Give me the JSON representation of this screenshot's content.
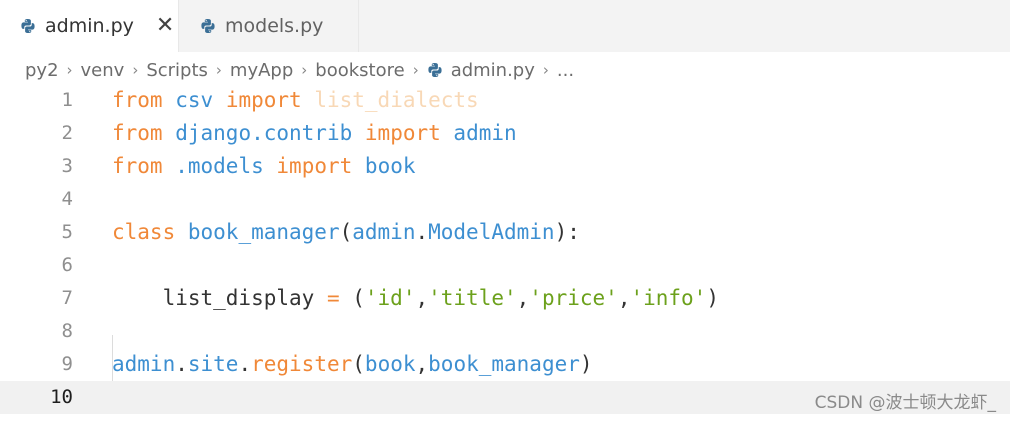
{
  "tabs": [
    {
      "label": "admin.py",
      "active": true
    },
    {
      "label": "models.py",
      "active": false
    }
  ],
  "close_glyph": "✕",
  "breadcrumb": [
    "py2",
    "venv",
    "Scripts",
    "myApp",
    "bookstore",
    "admin.py",
    "..."
  ],
  "breadcrumb_sep": "›",
  "colors": {
    "keyword": "#f08838",
    "identifier": "#3d8fd1",
    "string": "#6ca11c",
    "unused": "#f8d8b6",
    "text": "#333333",
    "line_number": "#8f8f8f",
    "current_line_bg": "#f1f1f1"
  },
  "code_lines": [
    {
      "num": "1",
      "tokens": [
        [
          "kw",
          "from"
        ],
        [
          "txt",
          " "
        ],
        [
          "fn",
          "csv"
        ],
        [
          "txt",
          " "
        ],
        [
          "kw",
          "import"
        ],
        [
          "txt",
          " "
        ],
        [
          "dim",
          "list_dialects"
        ]
      ]
    },
    {
      "num": "2",
      "tokens": [
        [
          "kw",
          "from"
        ],
        [
          "txt",
          " "
        ],
        [
          "fn",
          "django.contrib"
        ],
        [
          "txt",
          " "
        ],
        [
          "kw",
          "import"
        ],
        [
          "txt",
          " "
        ],
        [
          "fn",
          "admin"
        ]
      ]
    },
    {
      "num": "3",
      "tokens": [
        [
          "kw",
          "from"
        ],
        [
          "txt",
          " "
        ],
        [
          "fn",
          ".models"
        ],
        [
          "txt",
          " "
        ],
        [
          "kw",
          "import"
        ],
        [
          "txt",
          " "
        ],
        [
          "fn",
          "book"
        ]
      ]
    },
    {
      "num": "4",
      "tokens": []
    },
    {
      "num": "5",
      "tokens": [
        [
          "kw",
          "class"
        ],
        [
          "txt",
          " "
        ],
        [
          "fn",
          "book_manager"
        ],
        [
          "txt",
          "("
        ],
        [
          "fn",
          "admin"
        ],
        [
          "txt",
          "."
        ],
        [
          "fn",
          "ModelAdmin"
        ],
        [
          "txt",
          "):"
        ]
      ]
    },
    {
      "num": "6",
      "tokens": []
    },
    {
      "num": "7",
      "tokens": [
        [
          "txt",
          "    list_display "
        ],
        [
          "kw",
          "="
        ],
        [
          "txt",
          " ("
        ],
        [
          "str",
          "'id'"
        ],
        [
          "txt",
          ","
        ],
        [
          "str",
          "'title'"
        ],
        [
          "txt",
          ","
        ],
        [
          "str",
          "'price'"
        ],
        [
          "txt",
          ","
        ],
        [
          "str",
          "'info'"
        ],
        [
          "txt",
          ")"
        ]
      ]
    },
    {
      "num": "8",
      "tokens": []
    },
    {
      "num": "9",
      "tokens": [
        [
          "fn",
          "admin"
        ],
        [
          "txt",
          "."
        ],
        [
          "fn",
          "site"
        ],
        [
          "txt",
          "."
        ],
        [
          "kw",
          "register"
        ],
        [
          "txt",
          "("
        ],
        [
          "fn",
          "book"
        ],
        [
          "txt",
          ","
        ],
        [
          "fn",
          "book_manager"
        ],
        [
          "txt",
          ")"
        ]
      ]
    },
    {
      "num": "10",
      "tokens": [],
      "current": true
    }
  ],
  "watermark": "CSDN @波士顿大龙虾_"
}
